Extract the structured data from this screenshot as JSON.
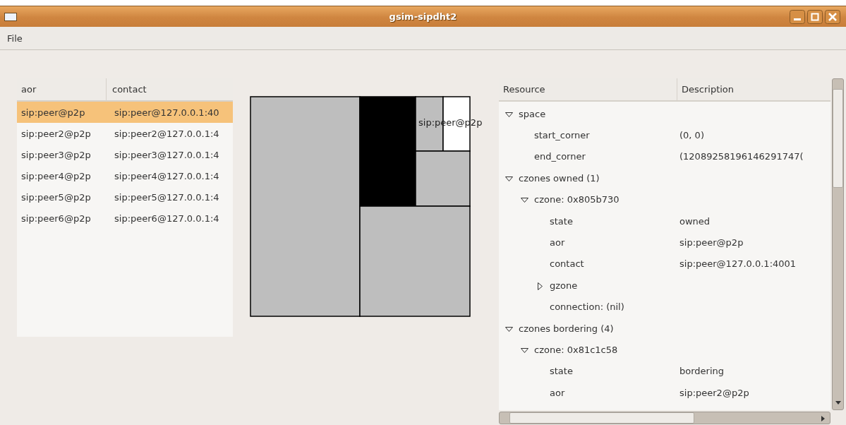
{
  "window": {
    "title": "gsim-sipdht2"
  },
  "menu": [
    "File"
  ],
  "peer_table": {
    "columns": [
      "aor",
      "contact"
    ],
    "rows": [
      {
        "aor": "sip:peer@p2p",
        "contact": "sip:peer@127.0.0.1:40",
        "selected": true
      },
      {
        "aor": "sip:peer2@p2p",
        "contact": "sip:peer2@127.0.0.1:4",
        "selected": false
      },
      {
        "aor": "sip:peer3@p2p",
        "contact": "sip:peer3@127.0.0.1:4",
        "selected": false
      },
      {
        "aor": "sip:peer4@p2p",
        "contact": "sip:peer4@127.0.0.1:4",
        "selected": false
      },
      {
        "aor": "sip:peer5@p2p",
        "contact": "sip:peer5@127.0.0.1:4",
        "selected": false
      },
      {
        "aor": "sip:peer6@p2p",
        "contact": "sip:peer6@127.0.0.1:4",
        "selected": false
      }
    ]
  },
  "zone_map": {
    "label": "sip:peer@p2p"
  },
  "resource_tree": {
    "columns": [
      "Resource",
      "Description"
    ],
    "nodes": [
      {
        "resource": "space",
        "expanded": true,
        "children": [
          {
            "resource": "start_corner",
            "description": "(0, 0)"
          },
          {
            "resource": "end_corner",
            "description": "(12089258196146291747("
          }
        ]
      },
      {
        "resource": "czones owned (1)",
        "expanded": true,
        "children": [
          {
            "resource": "czone: 0x805b730",
            "expanded": true,
            "children": [
              {
                "resource": "state",
                "description": "owned"
              },
              {
                "resource": "aor",
                "description": "sip:peer@p2p"
              },
              {
                "resource": "contact",
                "description": "sip:peer@127.0.0.1:4001"
              },
              {
                "resource": "gzone",
                "expanded": false
              },
              {
                "resource": "connection: (nil)"
              }
            ]
          }
        ]
      },
      {
        "resource": "czones bordering (4)",
        "expanded": true,
        "children": [
          {
            "resource": "czone: 0x81c1c58",
            "expanded": true,
            "children": [
              {
                "resource": "state",
                "description": "bordering"
              },
              {
                "resource": "aor",
                "description": "sip:peer2@p2p"
              }
            ]
          }
        ]
      }
    ]
  }
}
